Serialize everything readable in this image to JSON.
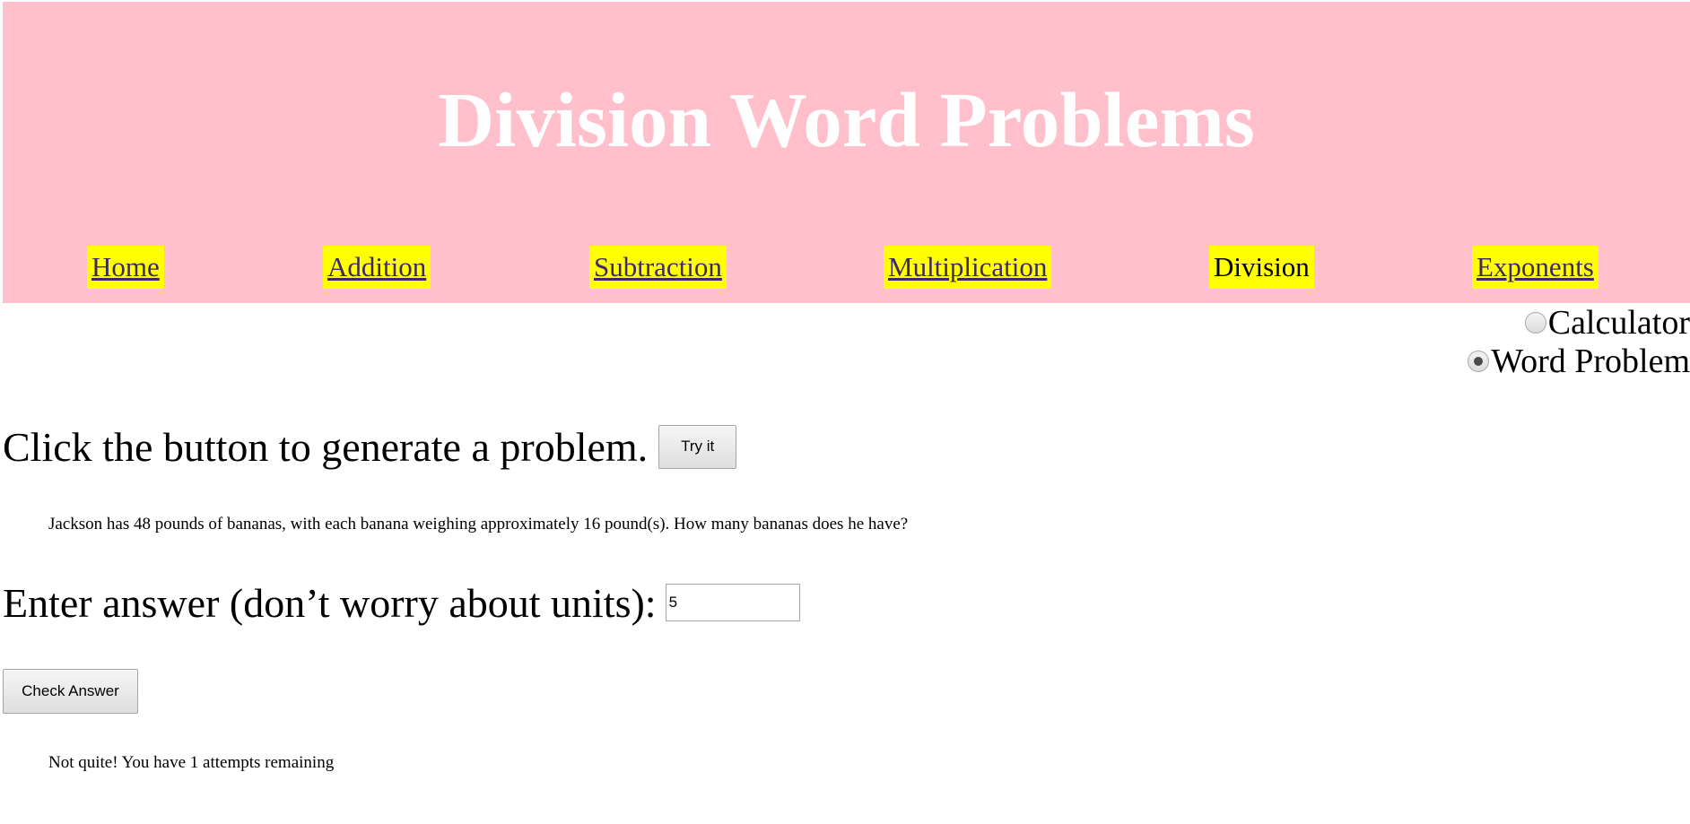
{
  "header": {
    "title": "Division Word Problems",
    "background_color": "#ffc0cb",
    "title_color": "#ffffff"
  },
  "nav": {
    "highlight_color": "#ffff00",
    "link_color": "#3b2a63",
    "items": [
      {
        "label": "Home",
        "active": false
      },
      {
        "label": "Addition",
        "active": false
      },
      {
        "label": "Subtraction",
        "active": false
      },
      {
        "label": "Multiplication",
        "active": false
      },
      {
        "label": "Division",
        "active": true
      },
      {
        "label": "Exponents",
        "active": false
      }
    ]
  },
  "mode": {
    "options": [
      {
        "label": "Calculator",
        "checked": false
      },
      {
        "label": "Word Problem",
        "checked": true
      }
    ]
  },
  "generator": {
    "prompt": "Click the button to generate a problem.",
    "button_label": "Try it"
  },
  "problem": {
    "text": "Jackson has 48 pounds of bananas, with each banana weighing approximately 16 pound(s). How many bananas does he have?"
  },
  "answer": {
    "prompt": "Enter answer (don’t worry about units):",
    "value": "5",
    "check_label": "Check Answer"
  },
  "feedback": {
    "text": "Not quite! You have 1 attempts remaining"
  }
}
